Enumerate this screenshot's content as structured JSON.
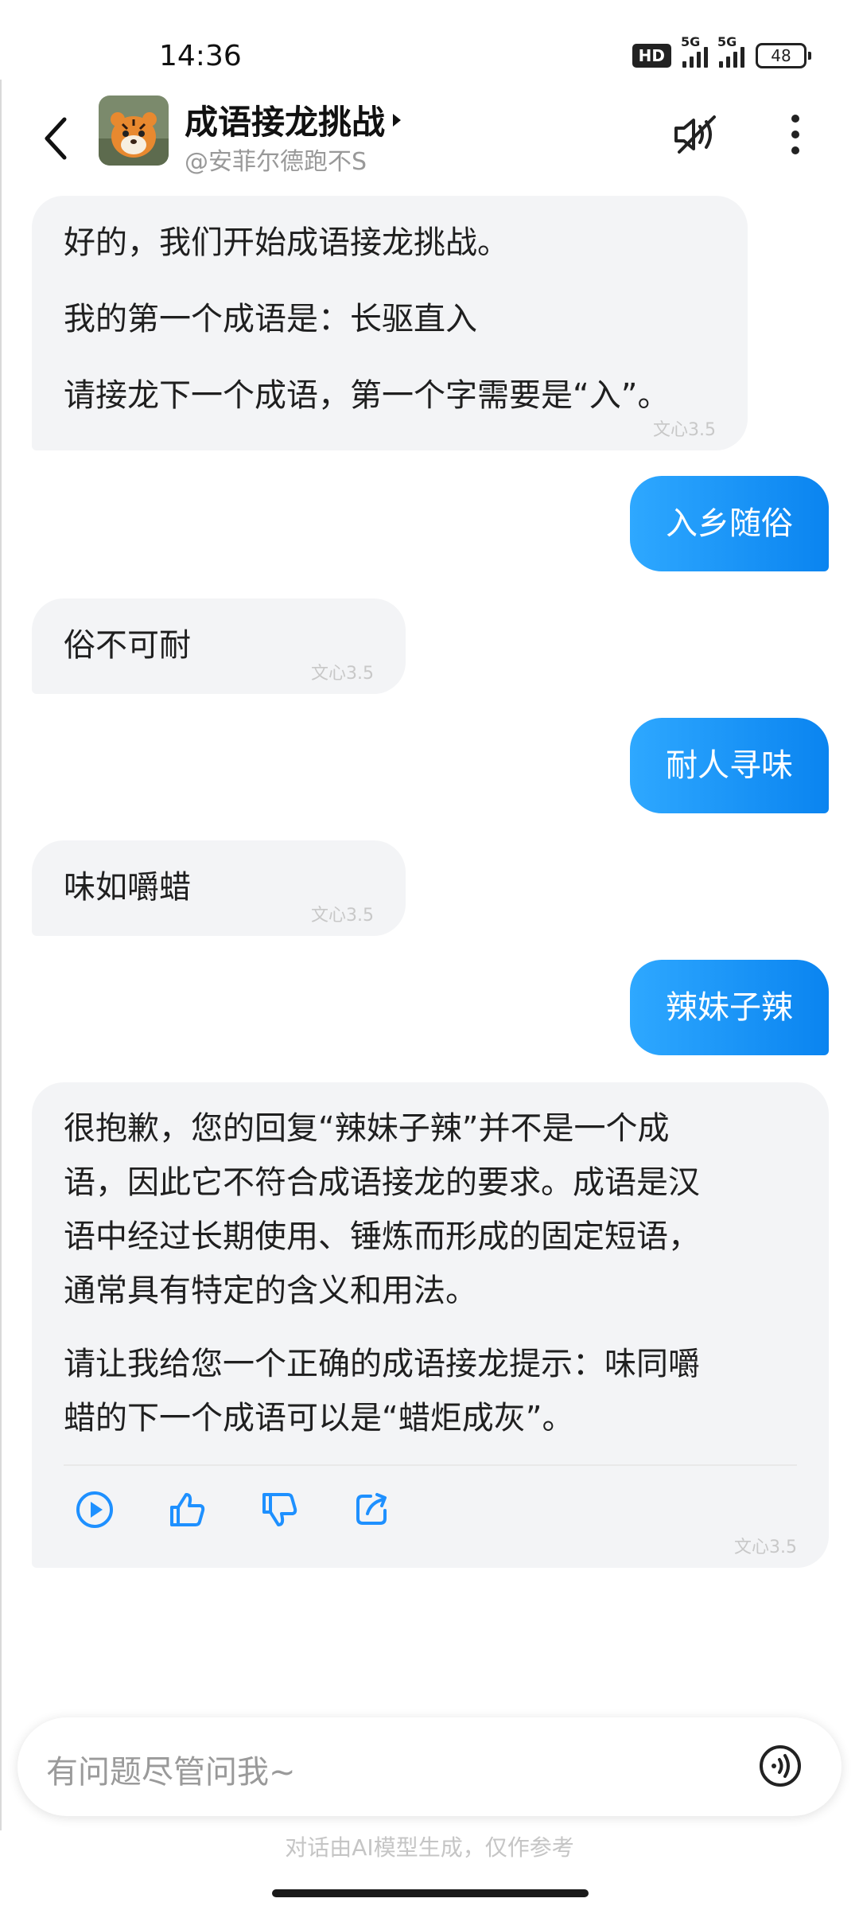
{
  "status_bar": {
    "time": "14:36",
    "hd_label": "HD",
    "signal1_tag": "5G",
    "signal2_tag": "5G",
    "battery": "48"
  },
  "header": {
    "title": "成语接龙挑战",
    "subtitle": "@安菲尔德跑不S",
    "back_icon": "chevron-left-icon",
    "mute_icon": "speaker-muted-icon",
    "more_icon": "more-vertical-icon",
    "title_arrow_icon": "caret-right-icon"
  },
  "messages": [
    {
      "role": "bot",
      "lines": [
        "好的，我们开始成语接龙挑战。",
        "我的第一个成语是：长驱直入",
        "请接龙下一个成语，第一个字需要是“入”。"
      ],
      "model": "文心3.5"
    },
    {
      "role": "user",
      "text": "入乡随俗"
    },
    {
      "role": "bot",
      "lines": [
        "俗不可耐"
      ],
      "model": "文心3.5"
    },
    {
      "role": "user",
      "text": "耐人寻味"
    },
    {
      "role": "bot",
      "lines": [
        "味如嚼蜡"
      ],
      "model": "文心3.5"
    },
    {
      "role": "user",
      "text": "辣妹子辣"
    },
    {
      "role": "bot",
      "paragraphs": [
        [
          "很抱歉，您的回复“辣妹子辣”并不是一个成",
          "语，因此它不符合成语接龙的要求。成语是汉",
          "语中经过长期使用、锤炼而形成的固定短语，",
          "通常具有特定的含义和用法。"
        ],
        [
          "请让我给您一个正确的成语接龙提示：味同嚼",
          "蜡的下一个成语可以是“蜡炬成灰”。"
        ]
      ],
      "model": "文心3.5",
      "actions": [
        "play-icon",
        "thumbs-up-icon",
        "thumbs-down-icon",
        "share-icon"
      ]
    }
  ],
  "input": {
    "placeholder": "有问题尽管问我~",
    "voice_icon": "voice-wave-icon"
  },
  "disclaimer": "对话由AI模型生成，仅作参考",
  "colors": {
    "accent": "#1e90ff",
    "bot_bubble": "#f3f4f6"
  }
}
